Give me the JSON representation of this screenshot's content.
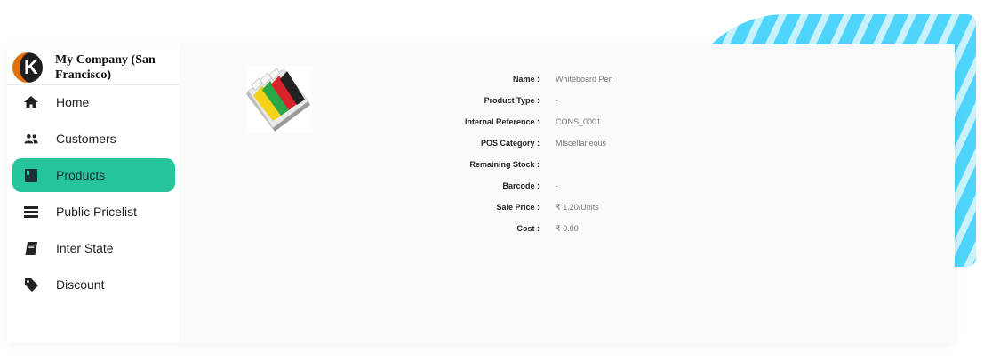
{
  "company": {
    "name": "My Company (San Francisco)",
    "logo_letter": "K"
  },
  "sidebar": {
    "items": [
      {
        "label": "Home",
        "icon": "home-icon",
        "active": false
      },
      {
        "label": "Customers",
        "icon": "users-icon",
        "active": false
      },
      {
        "label": "Products",
        "icon": "book-icon",
        "active": true
      },
      {
        "label": "Public Pricelist",
        "icon": "list-icon",
        "active": false
      },
      {
        "label": "Inter State",
        "icon": "ledger-icon",
        "active": false
      },
      {
        "label": "Discount",
        "icon": "tag-icon",
        "active": false
      }
    ]
  },
  "product": {
    "image_icon": "whiteboard-markers-image",
    "fields": [
      {
        "label": "Name :",
        "value": "Whiteboard Pen"
      },
      {
        "label": "Product Type :",
        "value": "-"
      },
      {
        "label": "Internal Reference :",
        "value": "CONS_0001"
      },
      {
        "label": "POS Category :",
        "value": "Miscellaneous"
      },
      {
        "label": "Remaining Stock :",
        "value": ""
      },
      {
        "label": "Barcode :",
        "value": "-"
      },
      {
        "label": "Sale Price :",
        "value": "₹ 1.20/Units"
      },
      {
        "label": "Cost :",
        "value": "₹ 0.00"
      }
    ]
  },
  "colors": {
    "accent": "#26c49a",
    "decor": "#4fd4fb",
    "background": "#f9fafa"
  }
}
